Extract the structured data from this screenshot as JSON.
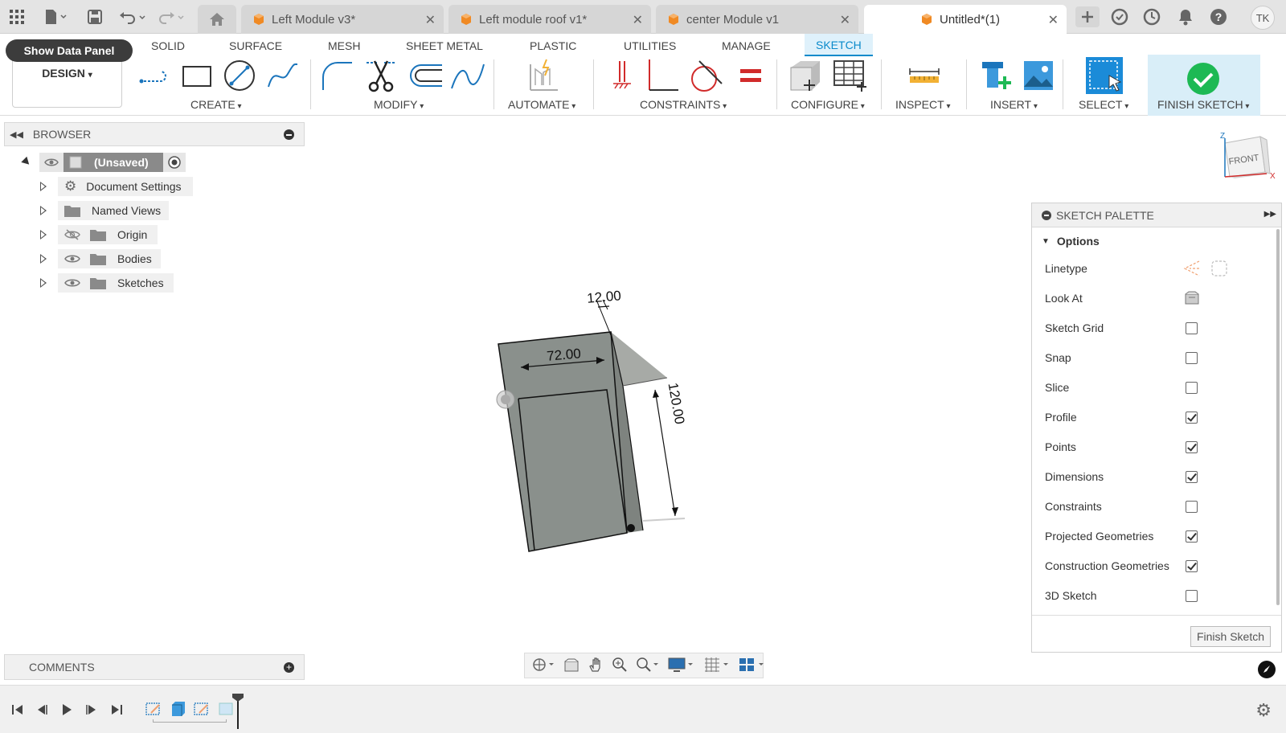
{
  "app": {
    "tabs": [
      {
        "label": "Left Module v3*"
      },
      {
        "label": "Left module roof v1*"
      },
      {
        "label": "center Module v1"
      },
      {
        "label": "Untitled*(1)"
      }
    ],
    "user_initials": "TK"
  },
  "ribbon": {
    "show_data_panel": "Show Data Panel",
    "workspace": "DESIGN",
    "tabs": [
      "SOLID",
      "SURFACE",
      "MESH",
      "SHEET METAL",
      "PLASTIC",
      "UTILITIES",
      "MANAGE",
      "SKETCH"
    ],
    "active_tab": "SKETCH",
    "groups": [
      "CREATE",
      "MODIFY",
      "AUTOMATE",
      "CONSTRAINTS",
      "CONFIGURE",
      "INSPECT",
      "INSERT",
      "SELECT",
      "FINISH SKETCH"
    ]
  },
  "browser": {
    "title": "BROWSER",
    "root": "(Unsaved)",
    "items": [
      {
        "label": "Document Settings",
        "icon": "gear-icon"
      },
      {
        "label": "Named Views",
        "icon": "folder-icon"
      },
      {
        "label": "Origin",
        "icon": "folder-icon",
        "visibility": "hidden"
      },
      {
        "label": "Bodies",
        "icon": "folder-icon",
        "visibility": "visible"
      },
      {
        "label": "Sketches",
        "icon": "folder-icon",
        "visibility": "visible"
      }
    ]
  },
  "viewcube": {
    "face": "FRONT",
    "axis_z": "Z",
    "axis_x": "X"
  },
  "sketch": {
    "dimensions": [
      "12.00",
      "72.00",
      "120.00"
    ]
  },
  "palette": {
    "title": "SKETCH PALETTE",
    "section": "Options",
    "rows": [
      {
        "label": "Linetype",
        "type": "icons"
      },
      {
        "label": "Look At",
        "type": "icon"
      },
      {
        "label": "Sketch Grid",
        "checked": false
      },
      {
        "label": "Snap",
        "checked": false
      },
      {
        "label": "Slice",
        "checked": false
      },
      {
        "label": "Profile",
        "checked": true
      },
      {
        "label": "Points",
        "checked": true
      },
      {
        "label": "Dimensions",
        "checked": true
      },
      {
        "label": "Constraints",
        "checked": false
      },
      {
        "label": "Projected Geometries",
        "checked": true
      },
      {
        "label": "Construction Geometries",
        "checked": true
      },
      {
        "label": "3D Sketch",
        "checked": false
      }
    ],
    "finish_button": "Finish Sketch"
  },
  "comments": {
    "title": "COMMENTS"
  },
  "colors": {
    "accent": "#0a8acb",
    "finish_green": "#1db954",
    "body_gray": "#8a908c",
    "constraint_red": "#d12b2b"
  }
}
